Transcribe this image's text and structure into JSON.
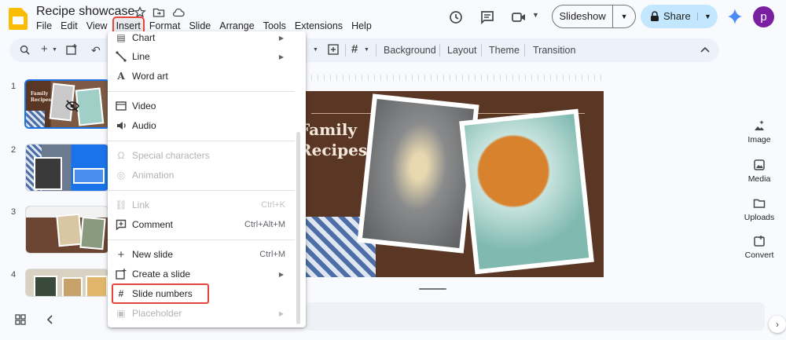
{
  "app": {
    "title": "Recipe showcase",
    "avatar_letter": "p"
  },
  "menubar": [
    "File",
    "Edit",
    "View",
    "Insert",
    "Format",
    "Slide",
    "Arrange",
    "Tools",
    "Extensions",
    "Help"
  ],
  "header": {
    "slideshow_label": "Slideshow",
    "share_label": "Share"
  },
  "toolbar": {
    "background": "Background",
    "layout": "Layout",
    "theme": "Theme",
    "transition": "Transition"
  },
  "filmstrip": {
    "numbers": [
      "1",
      "2",
      "3",
      "4"
    ],
    "thumb1_title": "Family Recipes"
  },
  "slide": {
    "title_line1": "Family",
    "title_line2": "Recipes"
  },
  "right_panel": {
    "image": "Image",
    "media": "Media",
    "uploads": "Uploads",
    "convert": "Convert"
  },
  "insert_menu": {
    "chart": "Chart",
    "line": "Line",
    "word_art": "Word art",
    "video": "Video",
    "audio": "Audio",
    "special_characters": "Special characters",
    "animation": "Animation",
    "link": "Link",
    "link_shortcut": "Ctrl+K",
    "comment": "Comment",
    "comment_shortcut": "Ctrl+Alt+M",
    "new_slide": "New slide",
    "new_slide_shortcut": "Ctrl+M",
    "create_slide": "Create a slide",
    "slide_numbers": "Slide numbers",
    "placeholder": "Placeholder"
  },
  "colors": {
    "accent": "#1a73e8",
    "highlight": "#e5463b",
    "share_bg": "#c2e7ff",
    "avatar": "#7b1fa2"
  }
}
